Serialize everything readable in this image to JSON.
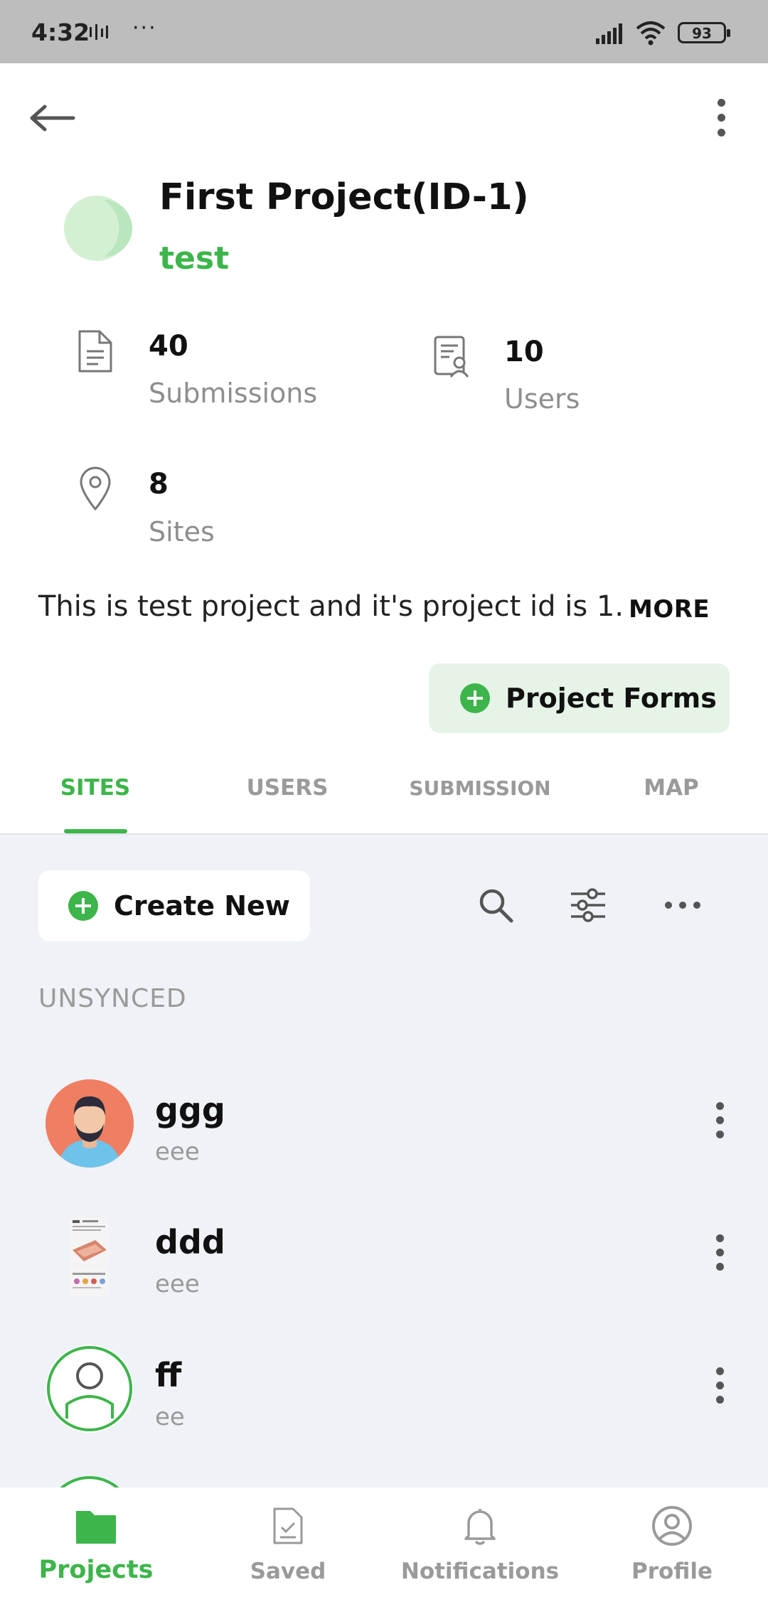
{
  "status_bar": {
    "time": "4:32",
    "dots": "···",
    "battery": "93",
    "network_glyph_icon": "network-activity-icon",
    "signal_icon": "signal-icon",
    "wifi_icon": "wifi-icon"
  },
  "header": {
    "back_icon": "arrow-left-icon",
    "menu_icon": "kebab-menu-icon"
  },
  "project": {
    "title": "First Project(ID-1)",
    "subtitle": "test",
    "description": "This is test project and it's project id is 1.",
    "more_label": "MORE",
    "forms_button_label": "Project Forms"
  },
  "stats": [
    {
      "value": "40",
      "label": "Submissions",
      "icon": "document-icon"
    },
    {
      "value": "10",
      "label": "Users",
      "icon": "user-document-icon"
    },
    {
      "value": "8",
      "label": "Sites",
      "icon": "location-pin-icon"
    }
  ],
  "tabs": [
    {
      "label": "SITES",
      "active": true
    },
    {
      "label": "USERS",
      "active": false
    },
    {
      "label": "SUBMISSION",
      "active": false
    },
    {
      "label": "MAP",
      "active": false
    }
  ],
  "toolbar": {
    "create_label": "Create New",
    "search_icon": "search-icon",
    "filter_icon": "filter-sliders-icon",
    "more_icon": "more-horizontal-icon"
  },
  "section": {
    "heading": "UNSYNCED"
  },
  "sites": [
    {
      "name": "ggg",
      "sub": "eee",
      "avatar": "man-avatar"
    },
    {
      "name": "ddd",
      "sub": "eee",
      "avatar": "document-thumbnail"
    },
    {
      "name": "ff",
      "sub": "ee",
      "avatar": "user-outline-avatar"
    }
  ],
  "bottom_nav": [
    {
      "label": "Projects",
      "icon": "folder-icon",
      "active": true
    },
    {
      "label": "Saved",
      "icon": "saved-document-icon",
      "active": false
    },
    {
      "label": "Notifications",
      "icon": "bell-icon",
      "active": false
    },
    {
      "label": "Profile",
      "icon": "profile-circle-icon",
      "active": false
    }
  ],
  "colors": {
    "accent": "#3db54a",
    "accent_light": "#e6f4e7",
    "content_bg": "#eff2f6",
    "status_bar": "#bdbdbd",
    "muted_text": "#9a9a9a"
  }
}
